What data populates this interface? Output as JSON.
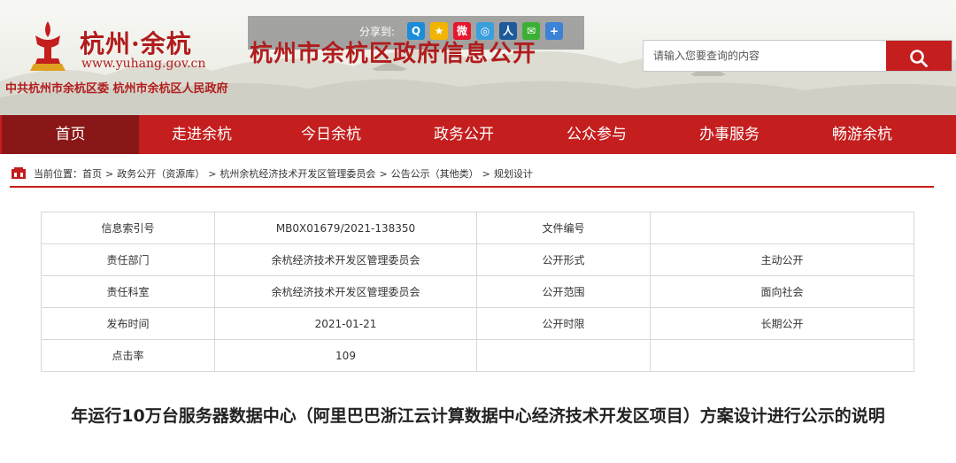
{
  "header": {
    "logo_name": "杭州·余杭",
    "logo_domain": "www.yuhang.gov.cn",
    "orgs": "中共杭州市余杭区委  杭州市余杭区人民政府",
    "site_title": "杭州市余杭区政府信息公开",
    "share_label": "分享到:",
    "share_icons": [
      {
        "name": "qq-share-icon",
        "glyph": "Q",
        "color": "#1a8cd8"
      },
      {
        "name": "qzone-share-icon",
        "glyph": "★",
        "color": "#f2b400"
      },
      {
        "name": "weibo-share-icon",
        "glyph": "微",
        "color": "#e6162d"
      },
      {
        "name": "tencent-weibo-share-icon",
        "glyph": "◎",
        "color": "#3a9fdc"
      },
      {
        "name": "renren-share-icon",
        "glyph": "人",
        "color": "#1e5a9b"
      },
      {
        "name": "wechat-share-icon",
        "glyph": "✉",
        "color": "#3cb034"
      },
      {
        "name": "more-share-icon",
        "glyph": "+",
        "color": "#3a83d6"
      }
    ]
  },
  "search": {
    "placeholder": "请输入您要查询的内容"
  },
  "nav": {
    "items": [
      "首页",
      "走进余杭",
      "今日余杭",
      "政务公开",
      "公众参与",
      "办事服务",
      "畅游余杭"
    ]
  },
  "breadcrumb": {
    "prefix": "当前位置：",
    "items": [
      "首页",
      "政务公开（资源库）",
      "杭州余杭经济技术开发区管理委员会",
      "公告公示（其他类）",
      "规划设计"
    ]
  },
  "info": {
    "rows": [
      {
        "k1": "信息索引号",
        "v1": "MB0X01679/2021-138350",
        "k2": "文件编号",
        "v2": ""
      },
      {
        "k1": "责任部门",
        "v1": "余杭经济技术开发区管理委员会",
        "k2": "公开形式",
        "v2": "主动公开"
      },
      {
        "k1": "责任科室",
        "v1": "余杭经济技术开发区管理委员会",
        "k2": "公开范围",
        "v2": "面向社会"
      },
      {
        "k1": "发布时间",
        "v1": "2021-01-21",
        "k2": "公开时限",
        "v2": "长期公开"
      },
      {
        "k1": "点击率",
        "v1": "109",
        "k2": "",
        "v2": ""
      }
    ]
  },
  "doc": {
    "title": "年运行10万台服务器数据中心（阿里巴巴浙江云计算数据中心经济技术开发区项目）方案设计进行公示的说明"
  },
  "colors": {
    "brand_red": "#c41e1e",
    "nav_active": "#8a1717"
  }
}
